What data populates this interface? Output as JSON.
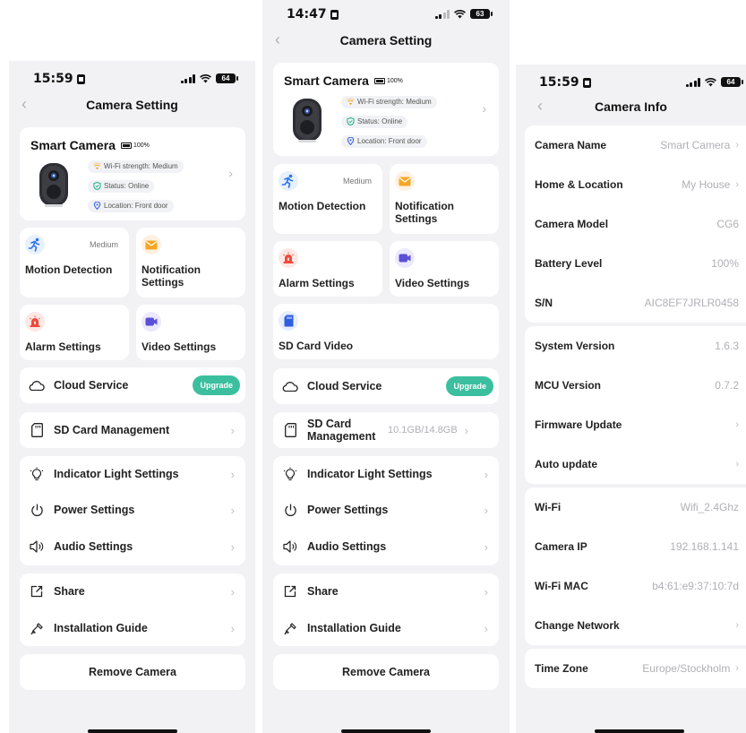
{
  "screen1": {
    "time": "15:59",
    "battery": "64",
    "title": "Camera Setting",
    "camera": {
      "name": "Smart Camera",
      "battery": "100%",
      "wifi": "Wi-Fi strength: Medium",
      "status": "Status: Online",
      "location": "Location: Front door"
    },
    "tiles": [
      {
        "label": "Motion Detection",
        "badge": "Medium",
        "icon": "running-person-icon"
      },
      {
        "label": "Notification Settings",
        "icon": "envelope-icon"
      },
      {
        "label": "Alarm Settings",
        "icon": "siren-icon"
      },
      {
        "label": "Video Settings",
        "icon": "video-camera-icon"
      }
    ],
    "cloud": {
      "label": "Cloud Service",
      "button": "Upgrade"
    },
    "sd": {
      "label": "SD Card Management"
    },
    "group1": [
      "Indicator Light Settings",
      "Power Settings",
      "Audio Settings"
    ],
    "group2": [
      "Share",
      "Installation Guide"
    ],
    "remove": "Remove Camera"
  },
  "screen2": {
    "time": "14:47",
    "battery": "63",
    "title": "Camera Setting",
    "camera": {
      "name": "Smart Camera",
      "battery": "100%",
      "wifi": "Wi-Fi strength: Medium",
      "status": "Status: Online",
      "location": "Location: Front door"
    },
    "tiles": [
      {
        "label": "Motion Detection",
        "badge": "Medium",
        "icon": "running-person-icon"
      },
      {
        "label": "Notification Settings",
        "icon": "envelope-icon"
      },
      {
        "label": "Alarm Settings",
        "icon": "siren-icon"
      },
      {
        "label": "Video Settings",
        "icon": "video-camera-icon"
      },
      {
        "label": "SD Card Video",
        "icon": "sd-card-icon"
      }
    ],
    "cloud": {
      "label": "Cloud Service",
      "button": "Upgrade"
    },
    "sd": {
      "label": "SD Card Management",
      "value": "10.1GB/14.8GB"
    },
    "group1": [
      "Indicator Light Settings",
      "Power Settings",
      "Audio Settings"
    ],
    "group2": [
      "Share",
      "Installation Guide"
    ],
    "remove": "Remove Camera"
  },
  "screen3": {
    "time": "15:59",
    "battery": "64",
    "title": "Camera Info",
    "groups": [
      [
        {
          "label": "Camera Name",
          "value": "Smart Camera",
          "chevron": true
        },
        {
          "label": "Home & Location",
          "value": "My House",
          "chevron": true
        },
        {
          "label": "Camera Model",
          "value": "CG6",
          "chevron": false
        },
        {
          "label": "Battery Level",
          "value": "100%",
          "chevron": false
        },
        {
          "label": "S/N",
          "value": "AIC8EF7JRLR0458",
          "chevron": false
        }
      ],
      [
        {
          "label": "System Version",
          "value": "1.6.3",
          "chevron": false
        },
        {
          "label": "MCU Version",
          "value": "0.7.2",
          "chevron": false
        },
        {
          "label": "Firmware Update",
          "value": "",
          "chevron": true
        },
        {
          "label": "Auto update",
          "value": "",
          "chevron": true
        }
      ],
      [
        {
          "label": "Wi-Fi",
          "value": "Wifi_2.4Ghz",
          "chevron": false
        },
        {
          "label": "Camera IP",
          "value": "192.168.1.141",
          "chevron": false
        },
        {
          "label": "Wi-Fi MAC",
          "value": "b4:61:e9:37:10:7d",
          "chevron": false
        },
        {
          "label": "Change Network",
          "value": "",
          "chevron": true
        }
      ],
      [
        {
          "label": "Time Zone",
          "value": "Europe/Stockholm",
          "chevron": true
        }
      ]
    ]
  }
}
